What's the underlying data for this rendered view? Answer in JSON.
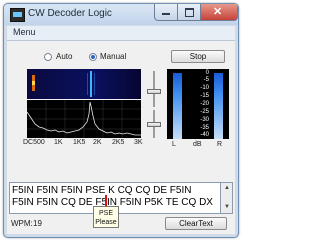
{
  "window": {
    "title": "CW Decoder Logic"
  },
  "menu": {
    "items": [
      "Menu"
    ]
  },
  "mode": {
    "auto_label": "Auto",
    "manual_label": "Manual",
    "selected": "Manual"
  },
  "stop_button": {
    "label": "Stop"
  },
  "spectrum": {
    "freq_labels": [
      "DC500",
      "1K",
      "1K5",
      "2K",
      "2K5",
      "3K"
    ]
  },
  "meters": {
    "scale": [
      "0",
      "-5",
      "-10",
      "-15",
      "-20",
      "-25",
      "-30",
      "-35",
      "-40"
    ],
    "labels": {
      "left": "L",
      "unit": "dB",
      "right": "R"
    },
    "left_level_fraction": 0.95,
    "right_level_fraction": 0.95
  },
  "decoded_text": {
    "line1": "F5IN F5IN F5IN PSE K CQ CQ DE F5IN",
    "line2": "F5IN F5IN CQ DE F5IN F5IN P5K TE CQ DX"
  },
  "tooltip": {
    "line1": "PSE",
    "line2": "Please"
  },
  "wpm": {
    "label": "WPM:",
    "value": "19"
  },
  "clear_button": {
    "label": "ClearText"
  },
  "colors": {
    "window_frame": "#cfdbe8",
    "meter_bar": "#3c8cf0",
    "cursor": "#e01010"
  },
  "icons": [
    "app-icon",
    "minimize-icon",
    "maximize-icon",
    "close-icon",
    "scroll-up-icon",
    "scroll-down-icon"
  ]
}
